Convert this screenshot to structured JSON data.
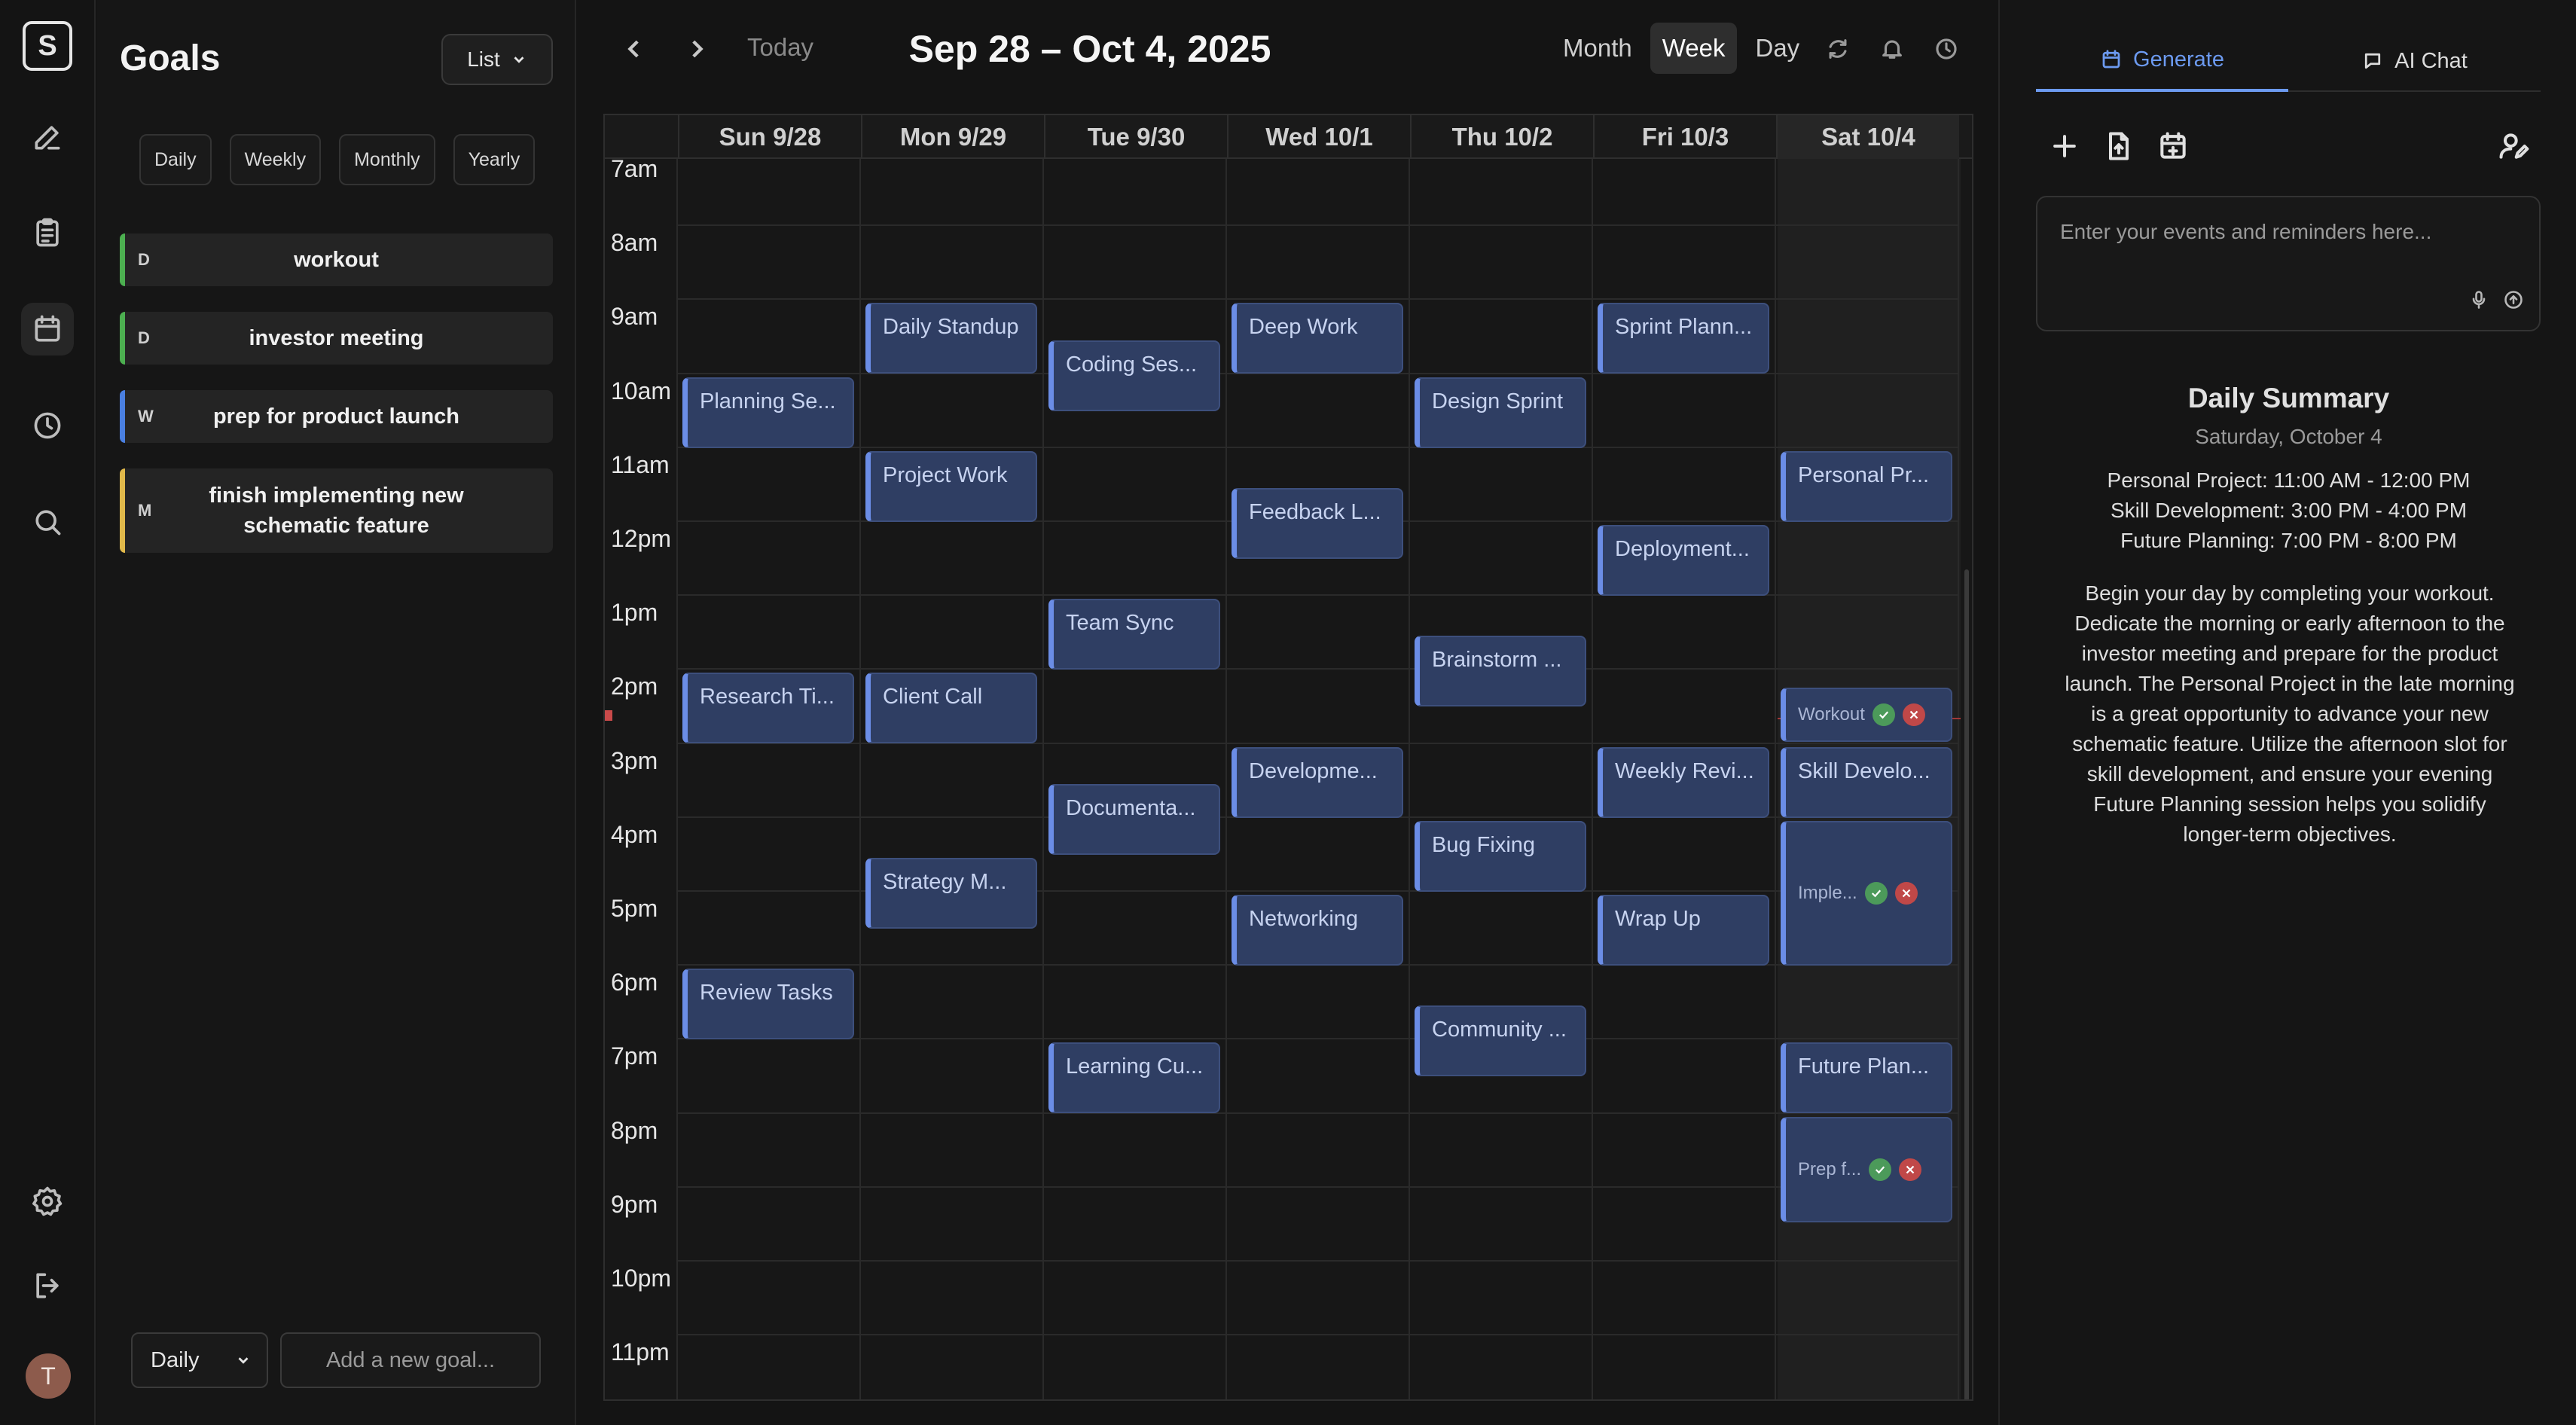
{
  "rail": {
    "logo": "S",
    "avatar_initial": "T"
  },
  "goals": {
    "title": "Goals",
    "view_mode": "List",
    "period_tabs": [
      "Daily",
      "Weekly",
      "Monthly",
      "Yearly"
    ],
    "items": [
      {
        "freq": "D",
        "text": "workout",
        "color": "#4caf50"
      },
      {
        "freq": "D",
        "text": "investor meeting",
        "color": "#4caf50"
      },
      {
        "freq": "W",
        "text": "prep for product launch",
        "color": "#4a7fe0"
      },
      {
        "freq": "M",
        "text": "finish implementing new schematic feature",
        "color": "#e0b84a"
      }
    ],
    "new_goal_frequency": "Daily",
    "new_goal_placeholder": "Add a new goal..."
  },
  "calendar": {
    "today_label": "Today",
    "range_title": "Sep 28 – Oct 4, 2025",
    "view_modes": [
      "Month",
      "Week",
      "Day"
    ],
    "active_view": "Week",
    "days": [
      "Sun 9/28",
      "Mon 9/29",
      "Tue 9/30",
      "Wed 10/1",
      "Thu 10/2",
      "Fri 10/3",
      "Sat 10/4"
    ],
    "hours": [
      "7am",
      "8am",
      "9am",
      "10am",
      "11am",
      "12pm",
      "1pm",
      "2pm",
      "3pm",
      "4pm",
      "5pm",
      "6pm",
      "7pm",
      "8pm",
      "9pm",
      "10pm",
      "11pm"
    ],
    "events": [
      {
        "day": 0,
        "start": 10,
        "title": "Planning Se..."
      },
      {
        "day": 0,
        "start": 14,
        "title": "Research Ti..."
      },
      {
        "day": 0,
        "start": 18,
        "title": "Review Tasks"
      },
      {
        "day": 1,
        "start": 9,
        "title": "Daily Standup"
      },
      {
        "day": 1,
        "start": 11,
        "title": "Project Work"
      },
      {
        "day": 1,
        "start": 14,
        "title": "Client Call"
      },
      {
        "day": 1,
        "start": 16.5,
        "title": "Strategy M..."
      },
      {
        "day": 2,
        "start": 9.5,
        "title": "Coding Ses..."
      },
      {
        "day": 2,
        "start": 13,
        "title": "Team Sync"
      },
      {
        "day": 2,
        "start": 15.5,
        "title": "Documenta..."
      },
      {
        "day": 2,
        "start": 19,
        "title": "Learning Cu..."
      },
      {
        "day": 3,
        "start": 9,
        "title": "Deep Work"
      },
      {
        "day": 3,
        "start": 11.5,
        "title": "Feedback L..."
      },
      {
        "day": 3,
        "start": 15,
        "title": "Developme..."
      },
      {
        "day": 3,
        "start": 17,
        "title": "Networking"
      },
      {
        "day": 4,
        "start": 10,
        "title": "Design Sprint"
      },
      {
        "day": 4,
        "start": 13.5,
        "title": "Brainstorm ..."
      },
      {
        "day": 4,
        "start": 16,
        "title": "Bug Fixing"
      },
      {
        "day": 4,
        "start": 18.5,
        "title": "Community ..."
      },
      {
        "day": 5,
        "start": 9,
        "title": "Sprint Plann..."
      },
      {
        "day": 5,
        "start": 12,
        "title": "Deployment..."
      },
      {
        "day": 5,
        "start": 15,
        "title": "Weekly Revi..."
      },
      {
        "day": 5,
        "start": 17,
        "title": "Wrap Up"
      },
      {
        "day": 6,
        "start": 11,
        "title": "Personal Pr..."
      },
      {
        "day": 6,
        "start": 15,
        "title": "Skill Develo..."
      },
      {
        "day": 6,
        "start": 19,
        "title": "Future Plan..."
      }
    ],
    "goal_events": [
      {
        "kind": "small",
        "start": 14.2,
        "title": "Workout"
      },
      {
        "kind": "tall",
        "start": 16,
        "title": "Imple..."
      },
      {
        "kind": "mid",
        "start": 20,
        "title": "Prep f..."
      }
    ]
  },
  "right": {
    "tabs": [
      "Generate",
      "AI Chat"
    ],
    "active_tab": "Generate",
    "input_placeholder": "Enter your events and reminders here...",
    "summary": {
      "title": "Daily Summary",
      "date": "Saturday, October 4",
      "items": [
        "Personal Project: 11:00 AM - 12:00 PM",
        "Skill Development: 3:00 PM - 4:00 PM",
        "Future Planning: 7:00 PM - 8:00 PM"
      ],
      "body": "Begin your day by completing your workout. Dedicate the morning or early afternoon to the investor meeting and prepare for the product launch. The Personal Project in the late morning is a great opportunity to advance your new schematic feature. Utilize the afternoon slot for skill development, and ensure your evening Future Planning session helps you solidify longer-term objectives."
    }
  }
}
